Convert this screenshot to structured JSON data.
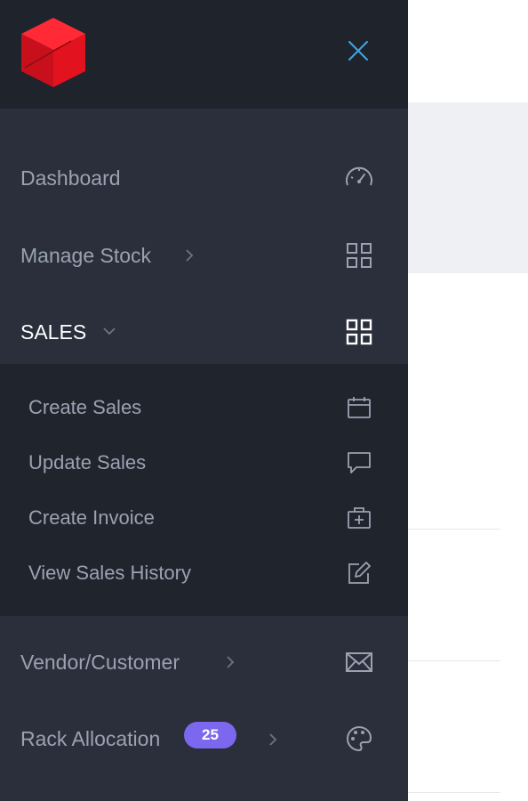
{
  "sidebar": {
    "close_icon": "close-icon",
    "items": [
      {
        "label": "Dashboard",
        "icon": "speedometer-icon"
      },
      {
        "label": "Manage Stock",
        "icon": "grid-icon"
      },
      {
        "label": "SALES",
        "icon": "grid-icon",
        "expanded": true
      },
      {
        "label": "Vendor/Customer",
        "icon": "mail-icon"
      },
      {
        "label": "Rack Allocation",
        "icon": "palette-icon",
        "badge": "25"
      }
    ],
    "sales_submenu": [
      {
        "label": "Create Sales",
        "icon": "calendar-icon"
      },
      {
        "label": "Update Sales",
        "icon": "message-icon"
      },
      {
        "label": "Create Invoice",
        "icon": "medical-bag-icon"
      },
      {
        "label": "View Sales History",
        "icon": "edit-icon"
      }
    ]
  },
  "colors": {
    "sidebar_bg": "#2a2f3b",
    "header_bg": "#1f232c",
    "submenu_bg": "#20242d",
    "text_muted": "#9aa2b1",
    "text_active": "#ffffff",
    "accent": "#3ea1e0",
    "badge": "#7b68ee",
    "logo_red": "#e0101e"
  }
}
